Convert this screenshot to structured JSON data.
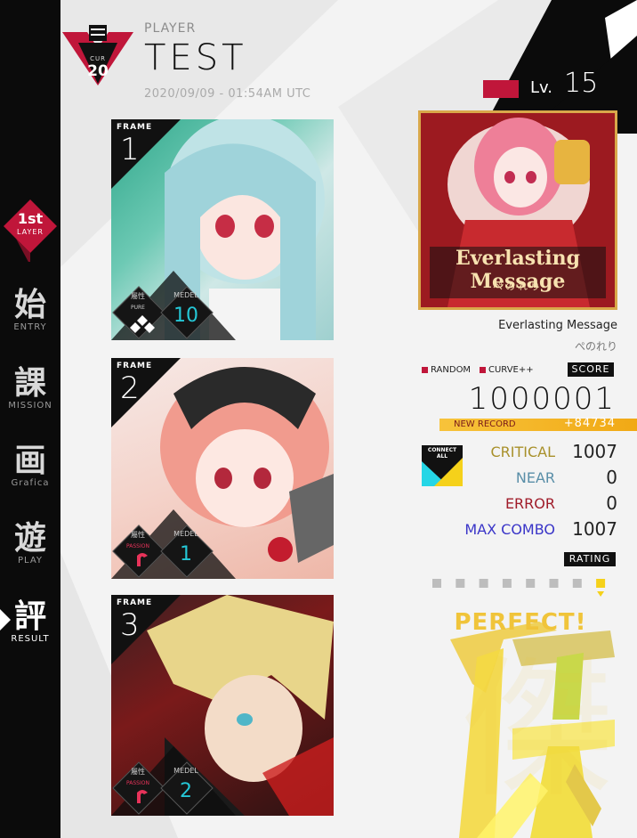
{
  "sidebar": {
    "layer_top": "1st",
    "layer_bottom": "LAYER",
    "items": [
      {
        "kanji": "始",
        "label": "ENTRY"
      },
      {
        "kanji": "課",
        "label": "MISSION"
      },
      {
        "kanji": "画",
        "label": "Grafica"
      },
      {
        "kanji": "遊",
        "label": "PLAY"
      },
      {
        "kanji": "評",
        "label": "RESULT"
      }
    ]
  },
  "player": {
    "label": "PLAYER",
    "name": "TEST",
    "date": "2020/09/09 - 01:54AM UTC",
    "emblem_top": "CUR",
    "emblem_value": "20"
  },
  "level": {
    "prefix": "Lv.",
    "value": "15"
  },
  "frames": [
    {
      "label": "FRAME",
      "number": "1",
      "attr_label": "屬性",
      "attr_sub": "PURE",
      "model_label": "MEDEL",
      "model_value": "10",
      "color": "#25c7d6"
    },
    {
      "label": "FRAME",
      "number": "2",
      "attr_label": "屬性",
      "attr_sub": "PASSION",
      "model_label": "MEDEL",
      "model_value": "1",
      "color": "#e8335a"
    },
    {
      "label": "FRAME",
      "number": "3",
      "attr_label": "屬性",
      "attr_sub": "PASSION",
      "model_label": "MEDEL",
      "model_value": "2",
      "color": "#e8335a"
    }
  ],
  "song": {
    "title": "Everlasting Message",
    "artist": "ぺのれり",
    "jacket_title": "Everlasting Message",
    "jacket_sub": "ぺのれり"
  },
  "modifiers": {
    "random": "RANDOM",
    "curve": "CURVE++"
  },
  "score": {
    "label": "SCORE",
    "value": "1000001",
    "new_record": "NEW RECORD",
    "delta": "+84734"
  },
  "connect_badge": {
    "line1": "CONNECT",
    "line2": "ALL"
  },
  "judgements": {
    "critical_label": "CRITICAL",
    "critical": "1007",
    "near_label": "NEAR",
    "near": "0",
    "error_label": "ERROR",
    "error": "0",
    "combo_label": "MAX COMBO",
    "combo": "1007"
  },
  "rating": {
    "label": "RATING",
    "grade": "PERFECT!",
    "kanji": "傑",
    "steps": 8,
    "selected": 8
  },
  "colors": {
    "accent_red": "#c0163a",
    "gold": "#f0c43a",
    "critical": "#a8902a",
    "near": "#5a8fa8",
    "error": "#a01c2a",
    "combo": "#3a35c8"
  }
}
